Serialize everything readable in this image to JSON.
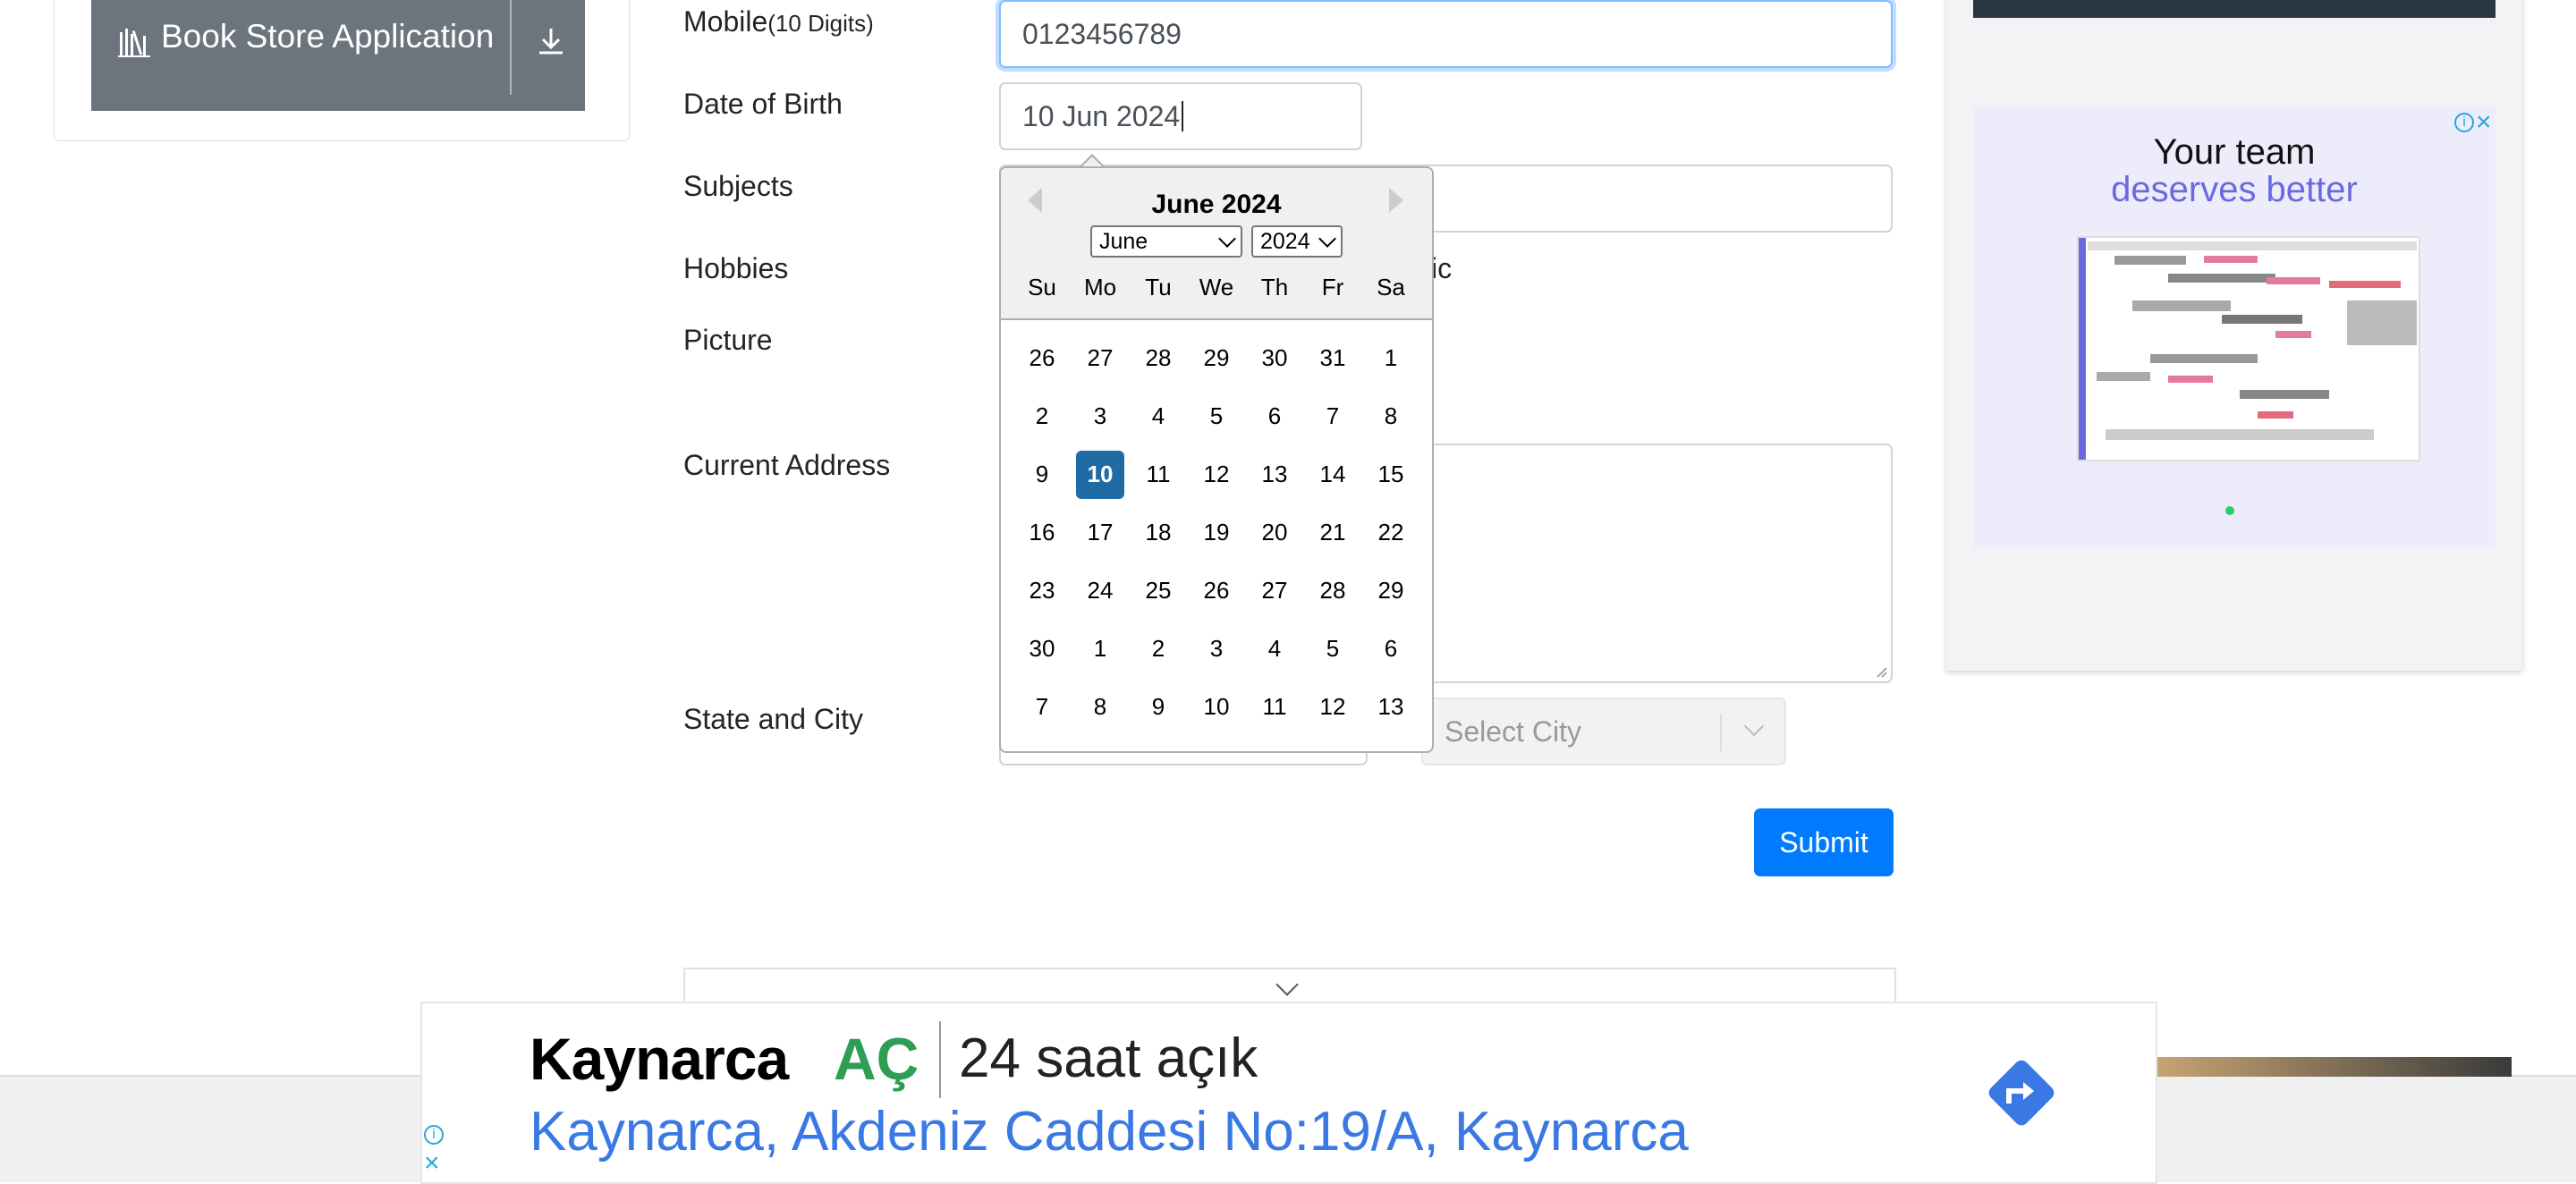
{
  "left_card": {
    "book_store_label": "Book Store Application"
  },
  "form": {
    "mobile_label": "Mobile",
    "mobile_hint": "(10 Digits)",
    "mobile_value": "0123456789",
    "dob_label": "Date of Birth",
    "dob_value": "10 Jun 2024",
    "subjects_label": "Subjects",
    "hobbies_label": "Hobbies",
    "hobbies_partial": "ic",
    "picture_label": "Picture",
    "address_label": "Current Address",
    "state_city_label": "State and City",
    "city_placeholder": "Select City",
    "submit_label": "Submit"
  },
  "calendar": {
    "title": "June 2024",
    "month_select": "June",
    "year_select": "2024",
    "weekdays": [
      "Su",
      "Mo",
      "Tu",
      "We",
      "Th",
      "Fr",
      "Sa"
    ],
    "weeks": [
      [
        "26",
        "27",
        "28",
        "29",
        "30",
        "31",
        "1"
      ],
      [
        "2",
        "3",
        "4",
        "5",
        "6",
        "7",
        "8"
      ],
      [
        "9",
        "10",
        "11",
        "12",
        "13",
        "14",
        "15"
      ],
      [
        "16",
        "17",
        "18",
        "19",
        "20",
        "21",
        "22"
      ],
      [
        "23",
        "24",
        "25",
        "26",
        "27",
        "28",
        "29"
      ],
      [
        "30",
        "1",
        "2",
        "3",
        "4",
        "5",
        "6"
      ],
      [
        "7",
        "8",
        "9",
        "10",
        "11",
        "12",
        "13"
      ]
    ],
    "selected_day": "10"
  },
  "right_ad": {
    "line1": "Your team",
    "line2": "deserves better"
  },
  "bottom_ad": {
    "name": "Kaynarca",
    "status": "AÇ",
    "hours": "24 saat açık",
    "address": "Kaynarca, Akdeniz Caddesi No:19/A, Kaynarca"
  },
  "colors": {
    "primary": "#007bff",
    "selected_day": "#216ba5",
    "book_button": "#6c757d",
    "ad_green": "#2e9e55",
    "ad_blue": "#3a79e4"
  }
}
